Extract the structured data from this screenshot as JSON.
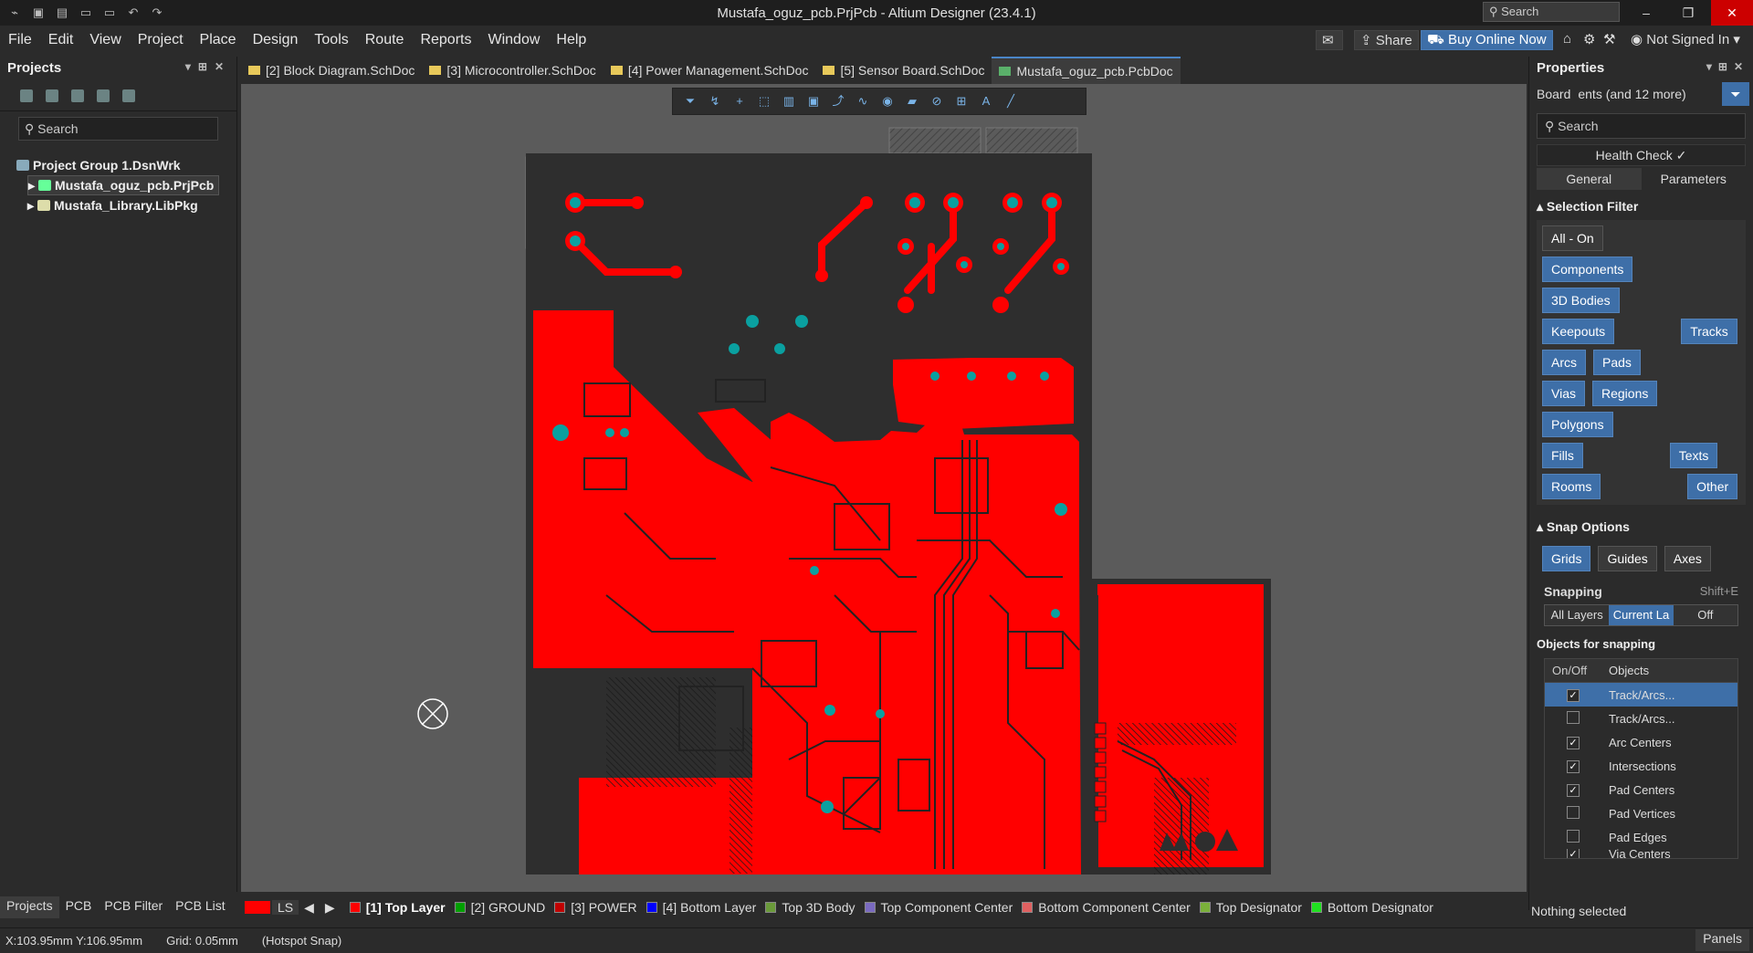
{
  "window": {
    "title": "Mustafa_oguz_pcb.PrjPcb - Altium Designer (23.4.1)",
    "search_placeholder": "Search"
  },
  "menu": [
    "File",
    "Edit",
    "View",
    "Project",
    "Place",
    "Design",
    "Tools",
    "Route",
    "Reports",
    "Window",
    "Help"
  ],
  "top_right": {
    "share": "Share",
    "buy": "Buy Online Now",
    "account": "Not Signed In"
  },
  "projects_panel": {
    "title": "Projects",
    "search_placeholder": "Search",
    "tree": {
      "group": "Project Group 1.DsnWrk",
      "project": "Mustafa_oguz_pcb.PrjPcb",
      "library": "Mustafa_Library.LibPkg"
    }
  },
  "doc_tabs": [
    "[2] Block Diagram.SchDoc",
    "[3] Microcontroller.SchDoc",
    "[4] Power Management.SchDoc",
    "[5] Sensor Board.SchDoc",
    "Mustafa_oguz_pcb.PcbDoc"
  ],
  "properties": {
    "title": "Properties",
    "board_label": "Board",
    "components_label": "ents (and 12 more)",
    "search_placeholder": "Search",
    "health_check": "Health Check ✓",
    "tabs": [
      "General",
      "Parameters"
    ],
    "selection_filter": {
      "title": "Selection Filter",
      "items": [
        "All - On",
        "Components",
        "3D Bodies",
        "Keepouts",
        "Tracks",
        "Arcs",
        "Pads",
        "Vias",
        "Regions",
        "Polygons",
        "Fills",
        "Texts",
        "Rooms",
        "Other"
      ]
    },
    "snap_options": {
      "title": "Snap Options",
      "buttons": [
        "Grids",
        "Guides",
        "Axes"
      ],
      "snapping_label": "Snapping",
      "snapping_shortcut": "Shift+E",
      "modes": [
        "All Layers",
        "Current La",
        "Off"
      ],
      "objects_title": "Objects for snapping",
      "table_headers": [
        "On/Off",
        "Objects"
      ],
      "rows": [
        {
          "label": "Track/Arcs...",
          "checked": true
        },
        {
          "label": "Track/Arcs...",
          "checked": false
        },
        {
          "label": "Arc Centers",
          "checked": true
        },
        {
          "label": "Intersections",
          "checked": true
        },
        {
          "label": "Pad Centers",
          "checked": true
        },
        {
          "label": "Pad Vertices",
          "checked": false
        },
        {
          "label": "Pad Edges",
          "checked": false
        },
        {
          "label": "Via Centers",
          "checked": true
        }
      ]
    },
    "nothing_selected": "Nothing selected"
  },
  "bottom_tabs": [
    "Projects",
    "PCB",
    "PCB Filter",
    "PCB List"
  ],
  "layers": [
    {
      "label": "LS",
      "color": "#ff0000"
    },
    {
      "label": "[1] Top Layer",
      "color": "#ff0000"
    },
    {
      "label": "[2] GROUND",
      "color": "#00a000"
    },
    {
      "label": "[3] POWER",
      "color": "#c00000"
    },
    {
      "label": "[4] Bottom Layer",
      "color": "#0000ff"
    },
    {
      "label": "Top 3D Body",
      "color": "#6a9a3a"
    },
    {
      "label": "Top Component Center",
      "color": "#7a6ac0"
    },
    {
      "label": "Bottom Component Center",
      "color": "#e06060"
    },
    {
      "label": "Top Designator",
      "color": "#7ab03a"
    },
    {
      "label": "Bottom Designator",
      "color": "#20e020"
    }
  ],
  "status": {
    "coords": "X:103.95mm Y:106.95mm",
    "grid": "Grid: 0.05mm",
    "snap": "(Hotspot Snap)",
    "panels": "Panels"
  },
  "colors": {
    "copper": "#ff0000",
    "board": "#2e2e2e",
    "accent": "#3e6fa8",
    "pad": "#0aa0a0"
  }
}
